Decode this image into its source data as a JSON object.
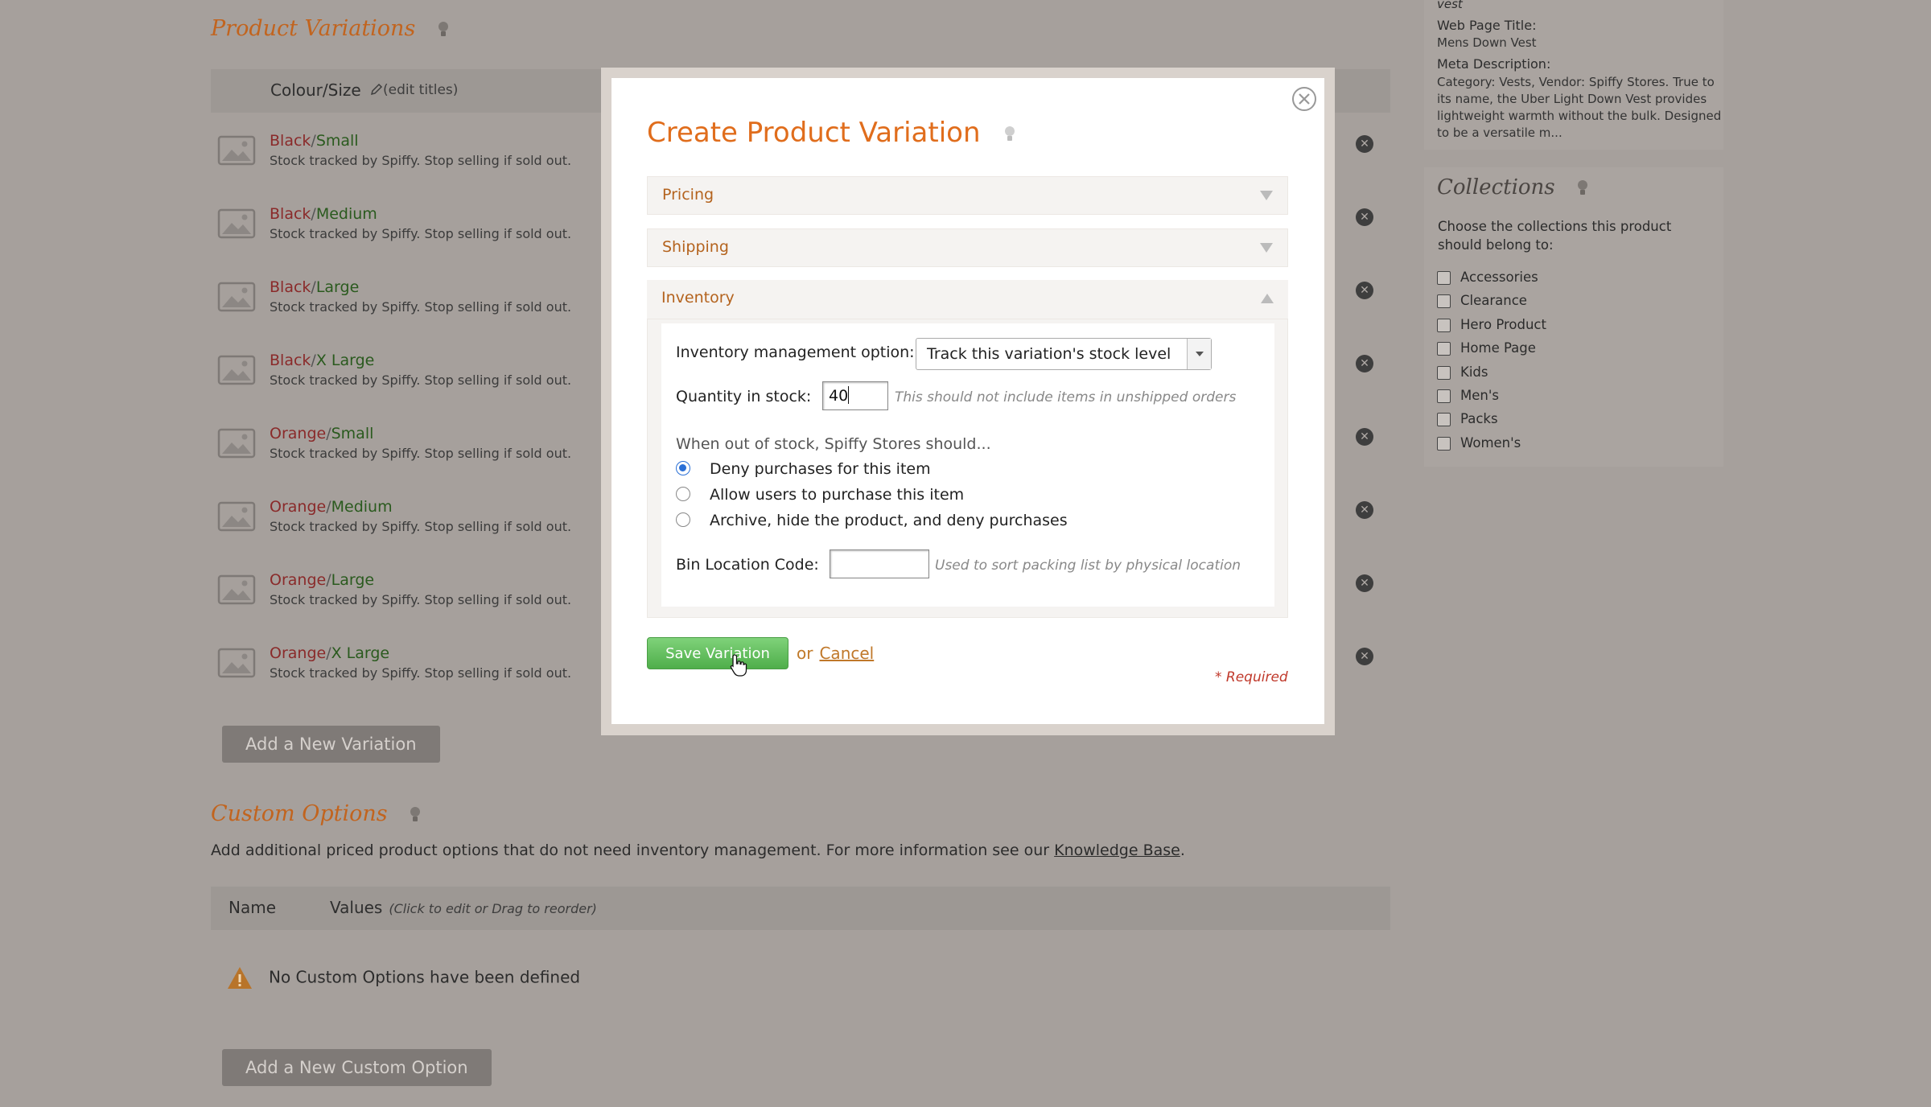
{
  "product_variations": {
    "title": "Product Variations",
    "header": {
      "col_title": "Colour/Size",
      "edit_titles": "(edit titles)"
    },
    "rows": [
      {
        "colour": "Black",
        "size": "Small",
        "sub": "Stock tracked by Spiffy. Stop selling if sold out."
      },
      {
        "colour": "Black",
        "size": "Medium",
        "sub": "Stock tracked by Spiffy. Stop selling if sold out."
      },
      {
        "colour": "Black",
        "size": "Large",
        "sub": "Stock tracked by Spiffy. Stop selling if sold out."
      },
      {
        "colour": "Black",
        "size": "X Large",
        "sub": "Stock tracked by Spiffy. Stop selling if sold out."
      },
      {
        "colour": "Orange",
        "size": "Small",
        "sub": "Stock tracked by Spiffy. Stop selling if sold out."
      },
      {
        "colour": "Orange",
        "size": "Medium",
        "sub": "Stock tracked by Spiffy. Stop selling if sold out."
      },
      {
        "colour": "Orange",
        "size": "Large",
        "sub": "Stock tracked by Spiffy. Stop selling if sold out."
      },
      {
        "colour": "Orange",
        "size": "X Large",
        "sub": "Stock tracked by Spiffy. Stop selling if sold out."
      }
    ],
    "separator": "/",
    "add_button": "Add a New Variation"
  },
  "custom_options": {
    "title": "Custom Options",
    "description_prefix": "Add additional priced product options that do not need inventory management. For more information see our ",
    "kb_link": "Knowledge Base",
    "description_suffix": ".",
    "header": {
      "name": "Name",
      "values": "Values",
      "values_hint": "(Click to edit or Drag to reorder)"
    },
    "empty_message": "No Custom Options have been defined",
    "add_button": "Add a New Custom Option"
  },
  "sidebar": {
    "top_cut_text": "vest",
    "web_page_title_label": "Web Page Title:",
    "web_page_title": "Mens Down Vest",
    "meta_description_label": "Meta Description:",
    "meta_description_lines": [
      "Category: Vests, Vendor: Spiffy Stores. True to",
      "its name, the Uber Light Down Vest provides",
      "lightweight warmth without the bulk. Designed",
      "to be a versatile m..."
    ],
    "collections_title": "Collections",
    "collections_desc": "Choose the collections this product should belong to:",
    "collections": [
      "Accessories",
      "Clearance",
      "Hero Product",
      "Home Page",
      "Kids",
      "Men's",
      "Packs",
      "Women's"
    ]
  },
  "modal": {
    "title": "Create Product Variation",
    "sections": {
      "pricing": "Pricing",
      "shipping": "Shipping",
      "inventory": "Inventory"
    },
    "inventory": {
      "mgmt_label": "Inventory management option:",
      "mgmt_value": "Track this variation's stock level",
      "qty_label": "Quantity in stock:",
      "qty_value": "40",
      "qty_hint": "This should not include items in unshipped orders",
      "oos_label": "When out of stock, Spiffy Stores should...",
      "radio_options": [
        "Deny purchases for this item",
        "Allow users to purchase this item",
        "Archive, hide the product, and deny purchases"
      ],
      "selected_radio": 0,
      "bin_label": "Bin Location Code:",
      "bin_value": "",
      "bin_hint": "Used to sort packing list by physical location"
    },
    "save_button": "Save Variation",
    "or_text": "or",
    "cancel_link": "Cancel",
    "required_text": "* Required"
  },
  "colors": {
    "overlay_bg": "#a6a09c",
    "accent_orange": "#e06d1c",
    "save_green": "#5cbf57",
    "required_red": "#c0392b",
    "radio_blue": "#2a6fd6"
  }
}
